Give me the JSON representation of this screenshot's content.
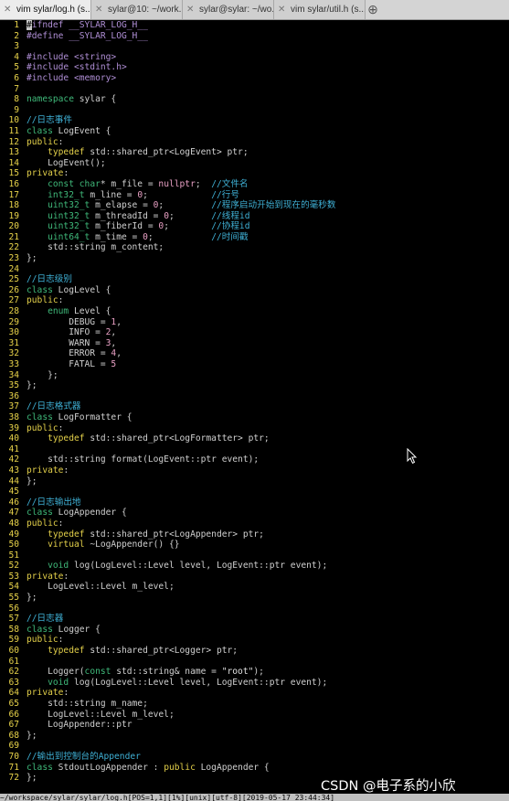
{
  "tabs": [
    {
      "label": "vim sylar/log.h (s...",
      "active": true
    },
    {
      "label": "sylar@10: ~/work...",
      "active": false
    },
    {
      "label": "sylar@sylar: ~/wo...",
      "active": false
    },
    {
      "label": "vim sylar/util.h (s...",
      "active": false
    }
  ],
  "tab_close_glyph": "✕",
  "new_tab_glyph": "⊕",
  "colors": {
    "preproc": "#b08fd6",
    "string": "#e0e0e0",
    "comment": "#3fb1d6",
    "keyword": "#e3d04a",
    "type": "#3fb97a",
    "number": "#e8a0c4",
    "plain": "#d0d0d0",
    "linenum": "#e8d34a"
  },
  "lines": [
    [
      [
        "preproc",
        "#ifndef"
      ],
      [
        "plain",
        " "
      ],
      [
        "preproc",
        "__SYLAR_LOG_H__"
      ]
    ],
    [
      [
        "preproc",
        "#define __SYLAR_LOG_H__"
      ]
    ],
    [],
    [
      [
        "preproc",
        "#include <string>"
      ]
    ],
    [
      [
        "preproc",
        "#include <stdint.h>"
      ]
    ],
    [
      [
        "preproc",
        "#include <memory>"
      ]
    ],
    [],
    [
      [
        "type",
        "namespace"
      ],
      [
        "plain",
        " sylar {"
      ]
    ],
    [],
    [
      [
        "comment",
        "//日志事件"
      ]
    ],
    [
      [
        "type",
        "class"
      ],
      [
        "plain",
        " LogEvent {"
      ]
    ],
    [
      [
        "keyword",
        "public"
      ],
      [
        "plain",
        ":"
      ]
    ],
    [
      [
        "plain",
        "    "
      ],
      [
        "keyword",
        "typedef"
      ],
      [
        "plain",
        " std::shared_ptr<LogEvent> ptr;"
      ]
    ],
    [
      [
        "plain",
        "    LogEvent();"
      ]
    ],
    [
      [
        "keyword",
        "private"
      ],
      [
        "plain",
        ":"
      ]
    ],
    [
      [
        "plain",
        "    "
      ],
      [
        "type",
        "const char"
      ],
      [
        "plain",
        "* m_file = "
      ],
      [
        "number",
        "nullptr"
      ],
      [
        "plain",
        ";  "
      ],
      [
        "comment",
        "//文件名"
      ]
    ],
    [
      [
        "plain",
        "    "
      ],
      [
        "type",
        "int32_t"
      ],
      [
        "plain",
        " m_line = "
      ],
      [
        "number",
        "0"
      ],
      [
        "plain",
        ";            "
      ],
      [
        "comment",
        "//行号"
      ]
    ],
    [
      [
        "plain",
        "    "
      ],
      [
        "type",
        "uint32_t"
      ],
      [
        "plain",
        " m_elapse = "
      ],
      [
        "number",
        "0"
      ],
      [
        "plain",
        ";         "
      ],
      [
        "comment",
        "//程序启动开始到现在的毫秒数"
      ]
    ],
    [
      [
        "plain",
        "    "
      ],
      [
        "type",
        "uint32_t"
      ],
      [
        "plain",
        " m_threadId = "
      ],
      [
        "number",
        "0"
      ],
      [
        "plain",
        ";       "
      ],
      [
        "comment",
        "//线程id"
      ]
    ],
    [
      [
        "plain",
        "    "
      ],
      [
        "type",
        "uint32_t"
      ],
      [
        "plain",
        " m_fiberId = "
      ],
      [
        "number",
        "0"
      ],
      [
        "plain",
        ";        "
      ],
      [
        "comment",
        "//协程id"
      ]
    ],
    [
      [
        "plain",
        "    "
      ],
      [
        "type",
        "uint64_t"
      ],
      [
        "plain",
        " m_time = "
      ],
      [
        "number",
        "0"
      ],
      [
        "plain",
        ";           "
      ],
      [
        "comment",
        "//时间戳"
      ]
    ],
    [
      [
        "plain",
        "    std::string m_content;"
      ]
    ],
    [
      [
        "plain",
        "};"
      ]
    ],
    [],
    [
      [
        "comment",
        "//日志级别"
      ]
    ],
    [
      [
        "type",
        "class"
      ],
      [
        "plain",
        " LogLevel {"
      ]
    ],
    [
      [
        "keyword",
        "public"
      ],
      [
        "plain",
        ":"
      ]
    ],
    [
      [
        "plain",
        "    "
      ],
      [
        "type",
        "enum"
      ],
      [
        "plain",
        " Level {"
      ]
    ],
    [
      [
        "plain",
        "        DEBUG = "
      ],
      [
        "number",
        "1"
      ],
      [
        "plain",
        ","
      ]
    ],
    [
      [
        "plain",
        "        INFO = "
      ],
      [
        "number",
        "2"
      ],
      [
        "plain",
        ","
      ]
    ],
    [
      [
        "plain",
        "        WARN = "
      ],
      [
        "number",
        "3"
      ],
      [
        "plain",
        ","
      ]
    ],
    [
      [
        "plain",
        "        ERROR = "
      ],
      [
        "number",
        "4"
      ],
      [
        "plain",
        ","
      ]
    ],
    [
      [
        "plain",
        "        FATAL = "
      ],
      [
        "number",
        "5"
      ]
    ],
    [
      [
        "plain",
        "    };"
      ]
    ],
    [
      [
        "plain",
        "};"
      ]
    ],
    [],
    [
      [
        "comment",
        "//日志格式器"
      ]
    ],
    [
      [
        "type",
        "class"
      ],
      [
        "plain",
        " LogFormatter {"
      ]
    ],
    [
      [
        "keyword",
        "public"
      ],
      [
        "plain",
        ":"
      ]
    ],
    [
      [
        "plain",
        "    "
      ],
      [
        "keyword",
        "typedef"
      ],
      [
        "plain",
        " std::shared_ptr<LogFormatter> ptr;"
      ]
    ],
    [],
    [
      [
        "plain",
        "    std::string format(LogEvent::ptr event);"
      ]
    ],
    [
      [
        "keyword",
        "private"
      ],
      [
        "plain",
        ":"
      ]
    ],
    [
      [
        "plain",
        "};"
      ]
    ],
    [],
    [
      [
        "comment",
        "//日志输出地"
      ]
    ],
    [
      [
        "type",
        "class"
      ],
      [
        "plain",
        " LogAppender {"
      ]
    ],
    [
      [
        "keyword",
        "public"
      ],
      [
        "plain",
        ":"
      ]
    ],
    [
      [
        "plain",
        "    "
      ],
      [
        "keyword",
        "typedef"
      ],
      [
        "plain",
        " std::shared_ptr<LogAppender> ptr;"
      ]
    ],
    [
      [
        "plain",
        "    "
      ],
      [
        "keyword",
        "virtual"
      ],
      [
        "plain",
        " ~LogAppender() {}"
      ]
    ],
    [],
    [
      [
        "plain",
        "    "
      ],
      [
        "type",
        "void"
      ],
      [
        "plain",
        " log(LogLevel::Level level, LogEvent::ptr event);"
      ]
    ],
    [
      [
        "keyword",
        "private"
      ],
      [
        "plain",
        ":"
      ]
    ],
    [
      [
        "plain",
        "    LogLevel::Level m_level;"
      ]
    ],
    [
      [
        "plain",
        "};"
      ]
    ],
    [],
    [
      [
        "comment",
        "//日志器"
      ]
    ],
    [
      [
        "type",
        "class"
      ],
      [
        "plain",
        " Logger {"
      ]
    ],
    [
      [
        "keyword",
        "public"
      ],
      [
        "plain",
        ":"
      ]
    ],
    [
      [
        "plain",
        "    "
      ],
      [
        "keyword",
        "typedef"
      ],
      [
        "plain",
        " std::shared_ptr<Logger> ptr;"
      ]
    ],
    [],
    [
      [
        "plain",
        "    Logger("
      ],
      [
        "type",
        "const"
      ],
      [
        "plain",
        " std::string& name = "
      ],
      [
        "string",
        "\"root\""
      ],
      [
        "plain",
        ");"
      ]
    ],
    [
      [
        "plain",
        "    "
      ],
      [
        "type",
        "void"
      ],
      [
        "plain",
        " log(LogLevel::Level level, LogEvent::ptr event);"
      ]
    ],
    [
      [
        "keyword",
        "private"
      ],
      [
        "plain",
        ":"
      ]
    ],
    [
      [
        "plain",
        "    std::string m_name;"
      ]
    ],
    [
      [
        "plain",
        "    LogLevel::Level m_level;"
      ]
    ],
    [
      [
        "plain",
        "    LogAppender::ptr"
      ]
    ],
    [
      [
        "plain",
        "};"
      ]
    ],
    [],
    [
      [
        "comment",
        "//输出到控制台的Appender"
      ]
    ],
    [
      [
        "type",
        "class"
      ],
      [
        "plain",
        " StdoutLogAppender : "
      ],
      [
        "keyword",
        "public"
      ],
      [
        "plain",
        " LogAppender {"
      ]
    ],
    [
      [
        "plain",
        "};"
      ]
    ]
  ],
  "statusline": "~/workspace/sylar/sylar/log.h[POS=1,1][1%][unix][utf-8][2019-05-17 23:44:34]",
  "watermark": "CSDN @电子系的小欣"
}
